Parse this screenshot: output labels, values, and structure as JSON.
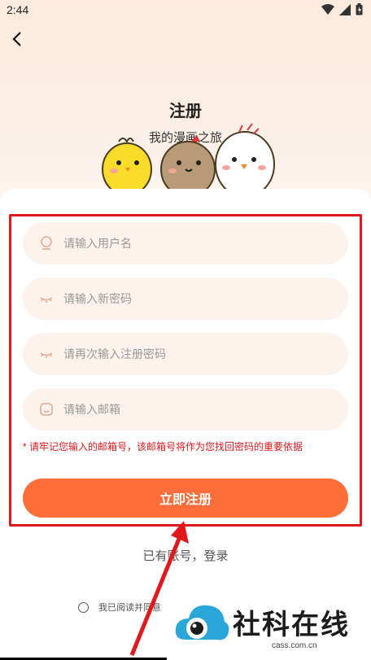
{
  "status": {
    "time": "2:44"
  },
  "header": {
    "title": "注册",
    "subtitle": "我的漫画之旅"
  },
  "form": {
    "username_placeholder": "请输入用户名",
    "password_placeholder": "请输入新密码",
    "confirm_placeholder": "请再次输入注册密码",
    "email_placeholder": "请输入邮箱",
    "notice": "* 请牢记您输入的邮箱号，该邮箱号将作为您找回密码的重要依据",
    "submit_label": "立即注册"
  },
  "footer": {
    "login_link": "已有账号，登录",
    "agreement": "我已阅读并同意"
  },
  "watermark": {
    "name": "社科在线",
    "url": "cass.com.cn"
  },
  "colors": {
    "accent": "#ff6e3a",
    "field_bg": "#fdf3ec",
    "highlight": "#e0191d"
  }
}
